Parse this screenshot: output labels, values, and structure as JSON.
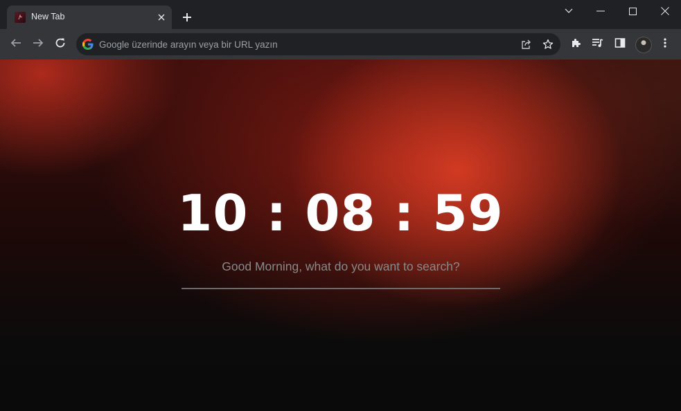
{
  "tab": {
    "title": "New Tab",
    "favicon": "custom-new-tab-favicon"
  },
  "window_controls": [
    "chevron-down-icon",
    "minimize-icon",
    "maximize-icon",
    "close-icon"
  ],
  "toolbar": {
    "back_icon": "arrow-left-icon",
    "forward_icon": "arrow-right-icon",
    "reload_icon": "reload-icon",
    "extensions_icon": "puzzle-icon",
    "media_icon": "media-queue-icon",
    "sidepanel_icon": "side-panel-icon",
    "menu_icon": "kebab-menu-icon"
  },
  "omnibox": {
    "placeholder": "Google üzerinde arayın veya bir URL yazın",
    "share_icon": "share-icon",
    "bookmark_icon": "star-icon"
  },
  "page": {
    "clock": "10 : 08 : 59",
    "greeting": "Good Morning, what do you want to search?"
  },
  "colors": {
    "frame": "#202124",
    "toolbar": "#35363a",
    "accent_red": "#c8321f",
    "clock_text": "#ffffff",
    "greeting_text": "#8a8a8a"
  }
}
